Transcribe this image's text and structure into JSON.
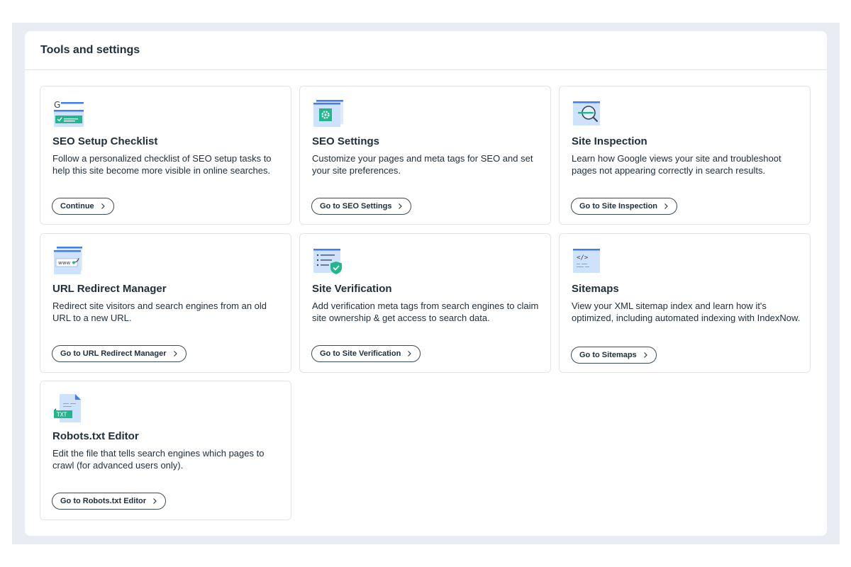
{
  "panel": {
    "title": "Tools and settings"
  },
  "cards": [
    {
      "title": "SEO Setup Checklist",
      "description": "Follow a personalized checklist of SEO setup tasks to help this site become more visible in online searches.",
      "button": "Continue",
      "icon": "seo-checklist-icon"
    },
    {
      "title": "SEO Settings",
      "description": "Customize your pages and meta tags for SEO and set your site preferences.",
      "button": "Go to SEO Settings",
      "icon": "settings-gear-icon"
    },
    {
      "title": "Site Inspection",
      "description": "Learn how Google views your site and troubleshoot pages not appearing correctly in search results.",
      "button": "Go to Site Inspection",
      "icon": "magnifier-icon"
    },
    {
      "title": "URL Redirect Manager",
      "description": "Redirect site visitors and search engines from an old URL to a new URL.",
      "button": "Go to URL Redirect Manager",
      "icon": "url-redirect-icon",
      "icon_text": "www"
    },
    {
      "title": "Site Verification",
      "description": "Add verification meta tags from search engines to claim site ownership & get access to search data.",
      "button": "Go to Site Verification",
      "icon": "verified-shield-icon"
    },
    {
      "title": "Sitemaps",
      "description": "View your XML sitemap index and learn how it's optimized, including automated indexing with IndexNow.",
      "button": "Go to Sitemaps",
      "icon": "code-sitemap-icon",
      "icon_text": "</>"
    },
    {
      "title": "Robots.txt Editor",
      "description": "Edit the file that tells search engines which pages to crawl (for advanced users only).",
      "button": "Go to Robots.txt Editor",
      "icon": "txt-file-icon",
      "icon_text": "TXT"
    }
  ],
  "colors": {
    "accent_blue": "#3f7ef2",
    "light_blue": "#cfe2fb",
    "green": "#23b58b",
    "border": "#dfe5eb",
    "backdrop": "#e9edf3"
  }
}
